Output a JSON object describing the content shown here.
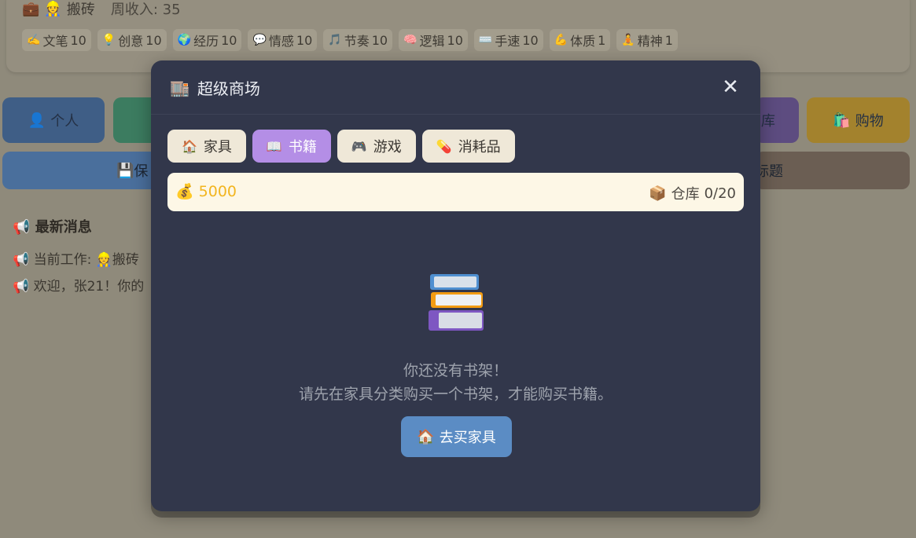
{
  "background": {
    "job": {
      "icon": "briefcase-icon",
      "worker_icon": "construction-worker-icon",
      "name": "搬砖",
      "income": "周收入: 35"
    },
    "stats": [
      {
        "icon": "✍️",
        "label": "文笔",
        "value": "10"
      },
      {
        "icon": "💡",
        "label": "创意",
        "value": "10"
      },
      {
        "icon": "🌍",
        "label": "经历",
        "value": "10"
      },
      {
        "icon": "💬",
        "label": "情感",
        "value": "10"
      },
      {
        "icon": "🎵",
        "label": "节奏",
        "value": "10"
      },
      {
        "icon": "🧠",
        "label": "逻辑",
        "value": "10"
      },
      {
        "icon": "⌨️",
        "label": "手速",
        "value": "10"
      },
      {
        "icon": "💪",
        "label": "体质",
        "value": "1"
      },
      {
        "icon": "🧘",
        "label": "精神",
        "value": "1"
      }
    ],
    "nav": {
      "personal": "个人",
      "storage": "库",
      "shopping": "购物"
    },
    "save_partial": "保",
    "title_partial": "标题",
    "news": {
      "title": "最新消息",
      "line1": "当前工作: ",
      "line1_job": "搬砖",
      "line2": "欢迎，张21！你的"
    },
    "colors": {
      "personal": "#3f5e86",
      "green": "#3c7c60",
      "purple": "#5d4c80",
      "shopping": "#a3822d",
      "save": "#4a6f9c",
      "title": "#6b5e53"
    }
  },
  "modal": {
    "icon": "office-building-icon",
    "title": "超级商场",
    "close": "✕",
    "tabs": [
      {
        "icon": "house-icon",
        "glyph": "🏠",
        "label": "家具",
        "active": false
      },
      {
        "icon": "book-icon",
        "glyph": "📖",
        "label": "书籍",
        "active": true
      },
      {
        "icon": "gamepad-icon",
        "glyph": "🎮",
        "label": "游戏",
        "active": false
      },
      {
        "icon": "pill-icon",
        "glyph": "💊",
        "label": "消耗品",
        "active": false
      }
    ],
    "money": {
      "icon": "money-bag-icon",
      "value": "5000"
    },
    "storage": {
      "icon": "box-icon",
      "label": "仓库",
      "value": "0/20"
    },
    "empty": {
      "icon": "books-stack-icon",
      "line1": "你还没有书架！",
      "line2": "请先在家具分类购买一个书架，才能购买书籍。"
    },
    "action": {
      "icon": "house-icon",
      "label": "去买家具"
    },
    "colors": {
      "panel": "#32374b",
      "active_tab": "#b48ee6",
      "tab": "#efe8d8",
      "money": "#f2b51f",
      "button": "#5b8cc4"
    }
  }
}
